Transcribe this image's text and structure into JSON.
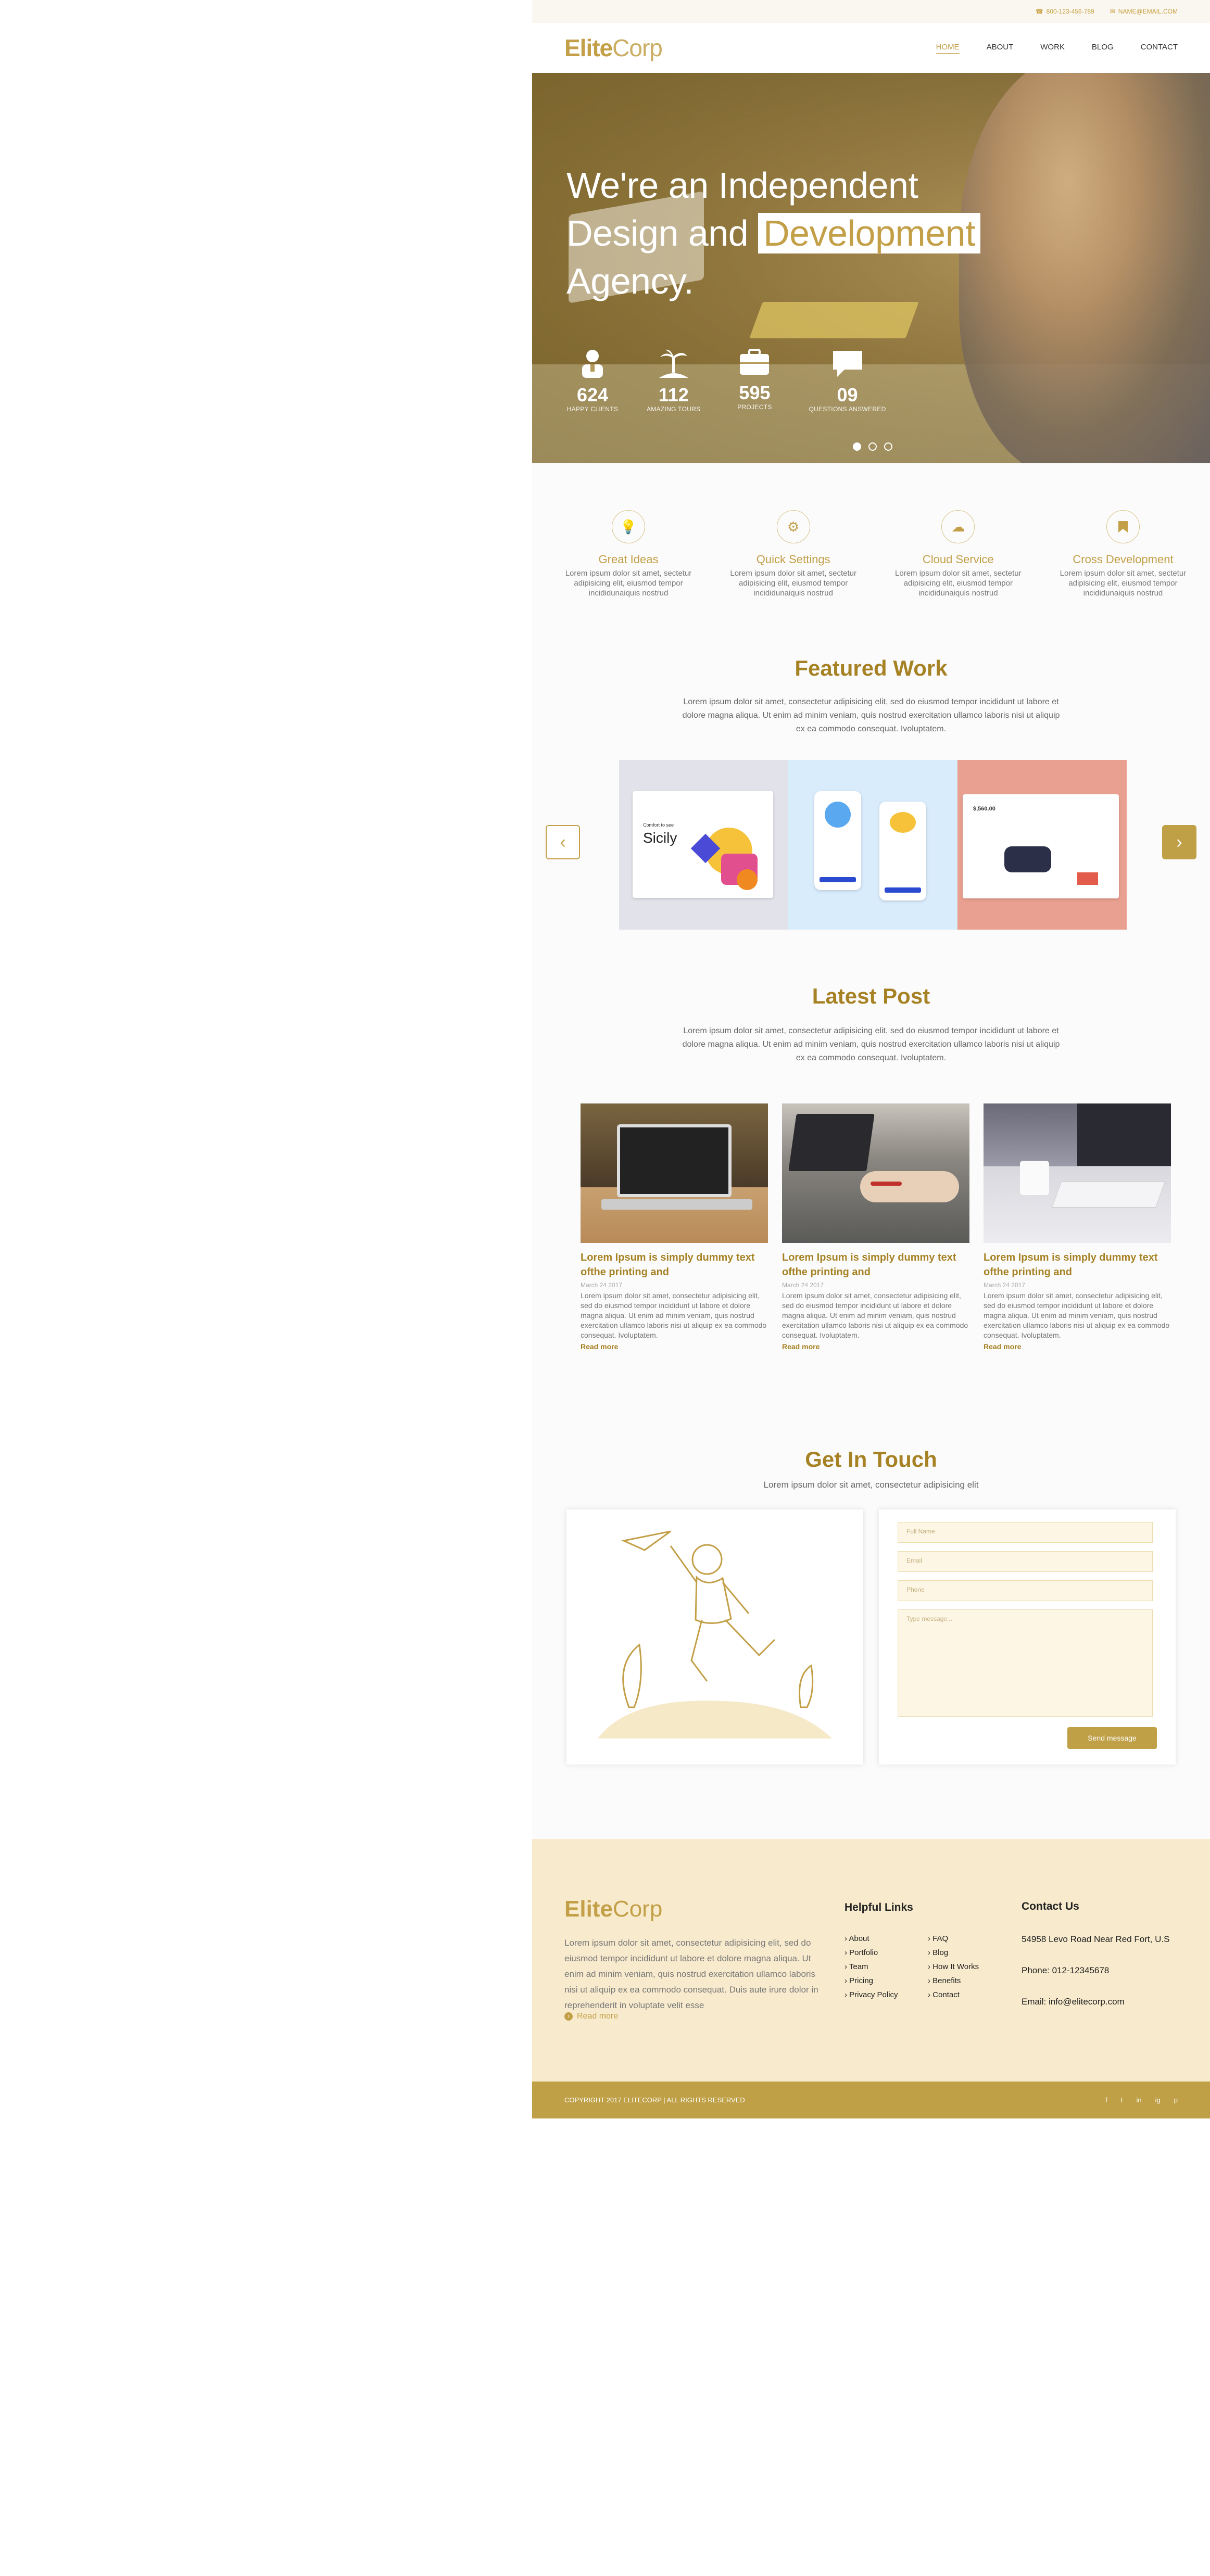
{
  "topbar": {
    "phone": "800-123-456-789",
    "email": "NAME@EMAIL.COM"
  },
  "header": {
    "logo_bold": "Elite",
    "logo_light": "Corp",
    "nav": [
      "HOME",
      "ABOUT",
      "WORK",
      "BLOG",
      "CONTACT"
    ]
  },
  "hero": {
    "line1": "We're an Independent",
    "line2a": "Design and",
    "line2b": "Development",
    "line3": "Agency.",
    "stats": [
      {
        "icon": "user-icon",
        "number": "624",
        "label": "HAPPY CLIENTS"
      },
      {
        "icon": "palm-tree-icon",
        "number": "112",
        "label": "AMAZING TOURS"
      },
      {
        "icon": "briefcase-icon",
        "number": "595",
        "label": "PROJECTS"
      },
      {
        "icon": "chat-bubble-icon",
        "number": "09",
        "label": "QUESTIONS ANSWERED"
      }
    ],
    "slides": 3,
    "active_slide": 1
  },
  "features": [
    {
      "icon": "lightbulb-icon",
      "title": "Great Ideas",
      "text": "Lorem ipsum dolor sit amet, sectetur adipisicing elit, eiusmod tempor incididunaiquis nostrud"
    },
    {
      "icon": "gears-icon",
      "title": "Quick Settings",
      "text": "Lorem ipsum dolor sit amet, sectetur adipisicing elit, eiusmod tempor incididunaiquis nostrud"
    },
    {
      "icon": "cloud-icon",
      "title": "Cloud Service",
      "text": "Lorem ipsum dolor sit amet, sectetur adipisicing elit, eiusmod tempor incididunaiquis nostrud"
    },
    {
      "icon": "bookmark-icon",
      "title": "Cross Development",
      "text": "Lorem ipsum dolor sit amet, sectetur adipisicing elit, eiusmod tempor incididunaiquis nostrud"
    }
  ],
  "featured_work": {
    "title": "Featured Work",
    "text": "Lorem ipsum dolor sit amet, consectetur adipisicing elit, sed do eiusmod tempor incididunt ut labore et dolore magna aliqua. Ut enim ad minim veniam, quis nostrud exercitation ullamco laboris nisi ut aliquip ex ea commodo consequat. Ivoluptatem.",
    "work1_heading": "Comfort to see",
    "work1_title": "Sicily",
    "work3_amount": "$,560.00"
  },
  "latest_post": {
    "title": "Latest Post",
    "text": "Lorem ipsum dolor sit amet, consectetur adipisicing elit, sed do eiusmod tempor incididunt ut labore et dolore magna aliqua. Ut enim ad minim veniam, quis nostrud exercitation ullamco laboris nisi ut aliquip ex ea commodo consequat. Ivoluptatem.",
    "posts": [
      {
        "title": "Lorem Ipsum is simply dummy text ofthe printing and",
        "date": "March 24 2017",
        "body": "Lorem ipsum dolor sit amet, consectetur adipisicing elit, sed do eiusmod tempor incididunt ut labore et dolore magna aliqua. Ut enim ad minim veniam, quis nostrud exercitation ullamco laboris nisi ut aliquip ex ea commodo consequat. Ivoluptatem.",
        "more": "Read more"
      },
      {
        "title": "Lorem Ipsum is simply dummy text ofthe printing and",
        "date": "March 24 2017",
        "body": "Lorem ipsum dolor sit amet, consectetur adipisicing elit, sed do eiusmod tempor incididunt ut labore et dolore magna aliqua. Ut enim ad minim veniam, quis nostrud exercitation ullamco laboris nisi ut aliquip ex ea commodo consequat. Ivoluptatem.",
        "more": "Read more"
      },
      {
        "title": "Lorem Ipsum is simply dummy text ofthe printing and",
        "date": "March 24 2017",
        "body": "Lorem ipsum dolor sit amet, consectetur adipisicing elit, sed do eiusmod tempor incididunt ut labore et dolore magna aliqua. Ut enim ad minim veniam, quis nostrud exercitation ullamco laboris nisi ut aliquip ex ea commodo consequat. Ivoluptatem.",
        "more": "Read more"
      }
    ]
  },
  "contact": {
    "title": "Get In Touch",
    "text": "Lorem ipsum dolor sit amet, consectetur adipisicing elit",
    "placeholders": {
      "name": "Full Name",
      "email": "Email",
      "phone": "Phone",
      "message": "Type message..."
    },
    "send": "Send message"
  },
  "footer": {
    "logo_bold": "Elite",
    "logo_light": "Corp",
    "about": "Lorem ipsum dolor sit amet, consectetur adipisicing elit, sed do eiusmod tempor incididunt ut labore et dolore magna aliqua. Ut enim ad minim veniam, quis nostrud exercitation ullamco laboris nisi ut aliquip ex ea commodo consequat. Duis aute irure dolor in reprehenderit in voluptate velit esse",
    "read_more": "Read more",
    "links_title": "Helpful Links",
    "links": [
      "About",
      "FAQ",
      "Portfolio",
      "Blog",
      "Team",
      "How It Works",
      "Pricing",
      "Benefits",
      "Privacy Policy",
      "Contact"
    ],
    "contact_title": "Contact Us",
    "address": "54958 Levo Road Near Red Fort, U.S",
    "phone": "Phone: 012-12345678",
    "email": "Email: info@elitecorp.com",
    "copyright": "COPYRIGHT 2017 ELITECORP | ALL RIGHTS RESERVED",
    "socials": [
      "f",
      "t",
      "in",
      "ig",
      "p"
    ]
  },
  "colors": {
    "accent": "#c3a048",
    "accent_dark": "#a68224",
    "footer_bg": "#f8ebcd",
    "copyright_bg": "#bfa047"
  }
}
